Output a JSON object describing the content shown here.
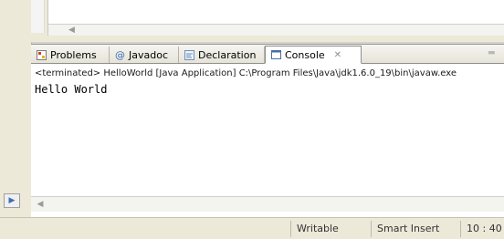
{
  "tabs": [
    {
      "label": "Problems",
      "icon": "problems-icon"
    },
    {
      "label": "Javadoc",
      "icon": "at-icon"
    },
    {
      "label": "Declaration",
      "icon": "declaration-icon"
    },
    {
      "label": "Console",
      "icon": "console-icon",
      "active": true
    }
  ],
  "console": {
    "close_glyph": "✕",
    "terminated_line": "<terminated> HelloWorld [Java Application] C:\\Program Files\\Java\\jdk1.6.0_19\\bin\\javaw.exe",
    "output": "Hello World"
  },
  "status_bar": {
    "writable": "Writable",
    "insert_mode": "Smart Insert",
    "position": "10 : 40"
  }
}
